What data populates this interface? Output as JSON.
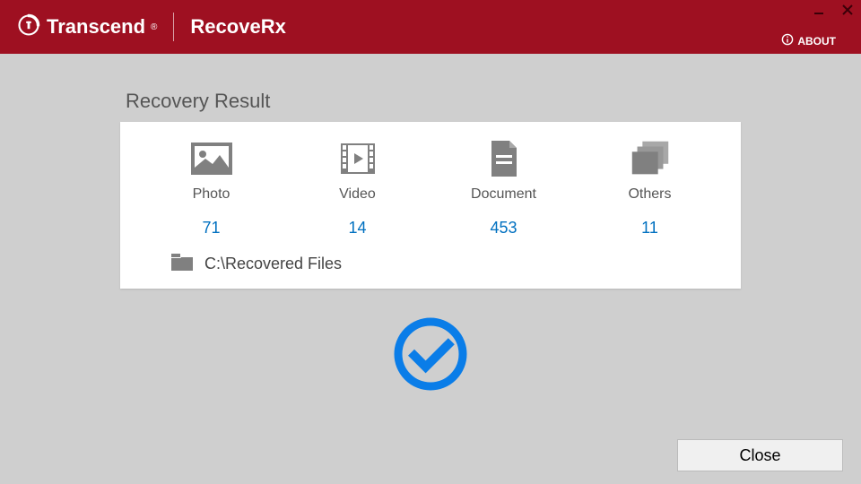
{
  "header": {
    "brand": "Transcend",
    "brand_reg": "®",
    "app_name": "RecoveRx",
    "about_label": "ABOUT"
  },
  "result": {
    "title": "Recovery Result",
    "categories": [
      {
        "label": "Photo",
        "count": 71
      },
      {
        "label": "Video",
        "count": 14
      },
      {
        "label": "Document",
        "count": 453
      },
      {
        "label": "Others",
        "count": 11
      }
    ],
    "path": "C:\\Recovered Files"
  },
  "footer": {
    "close_label": "Close"
  },
  "colors": {
    "brand_bg": "#9e1021",
    "accent_blue": "#0070c0",
    "success_blue": "#0a7de8",
    "icon_gray": "#808080"
  }
}
